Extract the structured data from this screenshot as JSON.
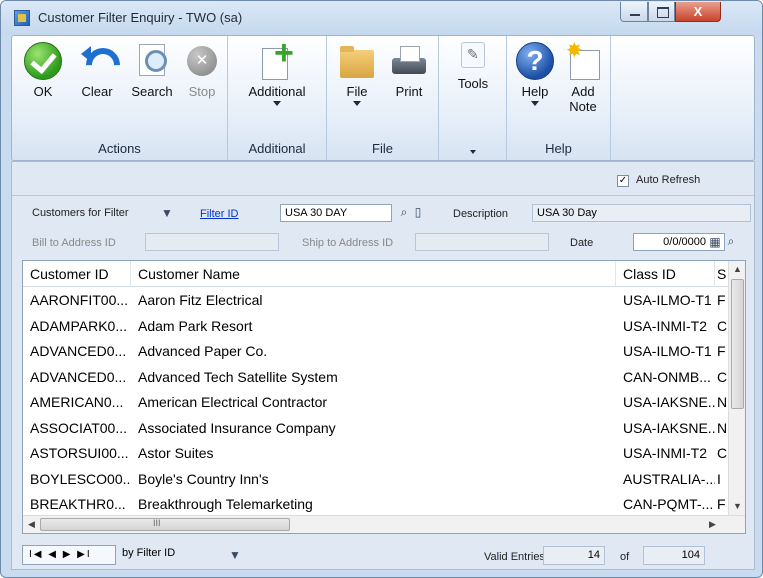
{
  "window": {
    "title": "Customer Filter Enquiry  -  TWO (sa)",
    "close_glyph": "X"
  },
  "ribbon": {
    "groups": [
      {
        "label": "Actions"
      },
      {
        "label": "Additional"
      },
      {
        "label": "File"
      },
      {
        "label": ""
      },
      {
        "label": "Help"
      }
    ],
    "ok": "OK",
    "clear": "Clear",
    "search": "Search",
    "stop": "Stop",
    "additional": "Additional",
    "file": "File",
    "print": "Print",
    "tools": "Tools",
    "help": "Help",
    "add_note_1": "Add",
    "add_note_2": "Note"
  },
  "filters": {
    "auto_refresh_label": "Auto Refresh",
    "auto_refresh_checked": true,
    "dropdown_value": "Customers for Filter",
    "filter_id_label": "Filter ID",
    "filter_id_value": "USA 30 DAY",
    "description_label": "Description",
    "description_value": "USA 30 Day",
    "bill_to_label": "Bill to Address ID",
    "ship_to_label": "Ship to Address ID",
    "date_label": "Date",
    "date_value": "0/0/0000"
  },
  "grid": {
    "columns": [
      "Customer ID",
      "Customer Name",
      "Class ID",
      "S"
    ],
    "rows": [
      {
        "id": "AARONFIT00...",
        "name": "Aaron Fitz Electrical",
        "class": "USA-ILMO-T1",
        "s": "F"
      },
      {
        "id": "ADAMPARK0...",
        "name": "Adam Park Resort",
        "class": "USA-INMI-T2",
        "s": "C"
      },
      {
        "id": "ADVANCED0...",
        "name": "Advanced Paper Co.",
        "class": "USA-ILMO-T1",
        "s": "F"
      },
      {
        "id": "ADVANCED0...",
        "name": "Advanced Tech Satellite System",
        "class": "CAN-ONMB...",
        "s": "C"
      },
      {
        "id": "AMERICAN0...",
        "name": "American Electrical Contractor",
        "class": "USA-IAKSNE...",
        "s": "N"
      },
      {
        "id": "ASSOCIAT00...",
        "name": "Associated Insurance Company",
        "class": "USA-IAKSNE...",
        "s": "N"
      },
      {
        "id": "ASTORSUI00...",
        "name": "Astor Suites",
        "class": "USA-INMI-T2",
        "s": "C"
      },
      {
        "id": "BOYLESCO00...",
        "name": "Boyle's Country Inn's",
        "class": "AUSTRALIA-...",
        "s": "I"
      },
      {
        "id": "BREAKTHR0...",
        "name": "Breakthrough Telemarketing",
        "class": "CAN-PQMT-...",
        "s": "F"
      }
    ],
    "hscroll_glyph": "III"
  },
  "footer": {
    "nav_glyphs": "I◀ ◀ ▶ ▶I",
    "sort_value": "by Filter ID",
    "valid_entries_label": "Valid Entries",
    "valid_entries_value": "14",
    "of_label": "of",
    "total_value": "104"
  }
}
